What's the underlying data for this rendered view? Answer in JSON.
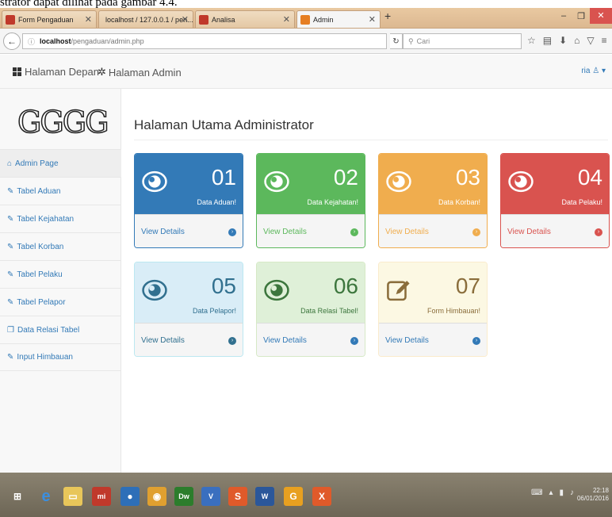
{
  "caption": "strator dapat dilihat pada gambar 4.4.",
  "browser": {
    "tabs": [
      {
        "title": "Form Pengaduan",
        "fav_color": "#c0392b"
      },
      {
        "title": "localhost / 127.0.0.1 / pen...",
        "fav_color": "#f0a94d"
      },
      {
        "title": "Analisa",
        "fav_color": "#c0392b"
      },
      {
        "title": "Admin",
        "fav_color": "#e67e22"
      }
    ],
    "url_host": "localhost",
    "url_path": "/pengaduan/admin.php",
    "search_placeholder": "Cari"
  },
  "header": {
    "brand": "Halaman Depan",
    "admin": "Halaman Admin",
    "user": "ria"
  },
  "sidebar": {
    "items": [
      {
        "label": "Admin Page",
        "icon": "home-icon",
        "glyph": "⌂"
      },
      {
        "label": "Tabel Aduan",
        "icon": "edit-icon",
        "glyph": "✎"
      },
      {
        "label": "Tabel Kejahatan",
        "icon": "edit-icon",
        "glyph": "✎"
      },
      {
        "label": "Tabel Korban",
        "icon": "edit-icon",
        "glyph": "✎"
      },
      {
        "label": "Tabel Pelaku",
        "icon": "edit-icon",
        "glyph": "✎"
      },
      {
        "label": "Tabel Pelapor",
        "icon": "edit-icon",
        "glyph": "✎"
      },
      {
        "label": "Data Relasi Tabel",
        "icon": "copy-icon",
        "glyph": "❐"
      },
      {
        "label": "Input Himbauan",
        "icon": "edit-icon",
        "glyph": "✎"
      }
    ]
  },
  "main": {
    "title": "Halaman Utama Administrator",
    "view_details": "View Details",
    "panels": [
      {
        "num": "01",
        "label": "Data Aduan!",
        "icon": "eye-icon",
        "variant": "primary"
      },
      {
        "num": "02",
        "label": "Data Kejahatan!",
        "icon": "eye-icon",
        "variant": "success"
      },
      {
        "num": "03",
        "label": "Data Korban!",
        "icon": "eye-icon",
        "variant": "warning"
      },
      {
        "num": "04",
        "label": "Data Pelaku!",
        "icon": "eye-icon",
        "variant": "danger"
      },
      {
        "num": "05",
        "label": "Data Pelapor!",
        "icon": "eye-icon",
        "variant": "info-light"
      },
      {
        "num": "06",
        "label": "Data Relasi Tabel!",
        "icon": "eye-icon",
        "variant": "success-light"
      },
      {
        "num": "07",
        "label": "Form Himbauan!",
        "icon": "edit-icon",
        "variant": "warning-light"
      }
    ]
  },
  "taskbar": {
    "time": "22:18",
    "date": "06/01/2016"
  }
}
